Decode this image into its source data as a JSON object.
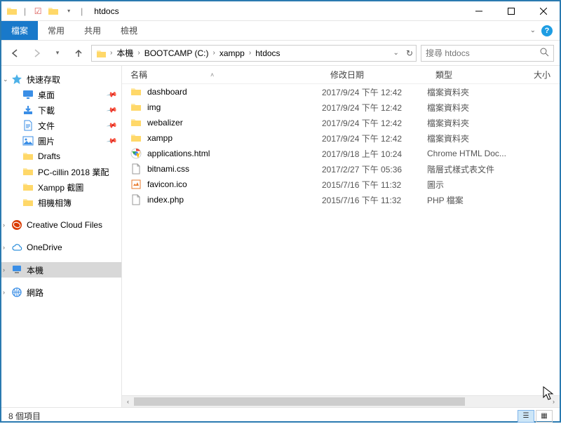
{
  "window": {
    "title": "htdocs"
  },
  "ribbon": {
    "file": "檔案",
    "home": "常用",
    "share": "共用",
    "view": "檢視"
  },
  "breadcrumb": [
    "本機",
    "BOOTCAMP (C:)",
    "xampp",
    "htdocs"
  ],
  "search": {
    "placeholder": "搜尋 htdocs"
  },
  "columns": {
    "name": "名稱",
    "date": "修改日期",
    "type": "類型",
    "size": "大小"
  },
  "sidebar": {
    "quick_access": "快速存取",
    "quick_items": [
      {
        "label": "桌面",
        "icon": "desktop",
        "pinned": true
      },
      {
        "label": "下載",
        "icon": "downloads",
        "pinned": true
      },
      {
        "label": "文件",
        "icon": "documents",
        "pinned": true
      },
      {
        "label": "圖片",
        "icon": "pictures",
        "pinned": true
      },
      {
        "label": "Drafts",
        "icon": "folder",
        "pinned": false
      },
      {
        "label": "PC-cillin 2018 業配",
        "icon": "folder",
        "pinned": false
      },
      {
        "label": "Xampp 截圖",
        "icon": "folder",
        "pinned": false
      },
      {
        "label": "相機相簿",
        "icon": "folder",
        "pinned": false
      }
    ],
    "creative_cloud": "Creative Cloud Files",
    "onedrive": "OneDrive",
    "this_pc": "本機",
    "network": "網路"
  },
  "files": [
    {
      "name": "dashboard",
      "date": "2017/9/24 下午 12:42",
      "type": "檔案資料夾",
      "icon": "folder"
    },
    {
      "name": "img",
      "date": "2017/9/24 下午 12:42",
      "type": "檔案資料夾",
      "icon": "folder"
    },
    {
      "name": "webalizer",
      "date": "2017/9/24 下午 12:42",
      "type": "檔案資料夾",
      "icon": "folder"
    },
    {
      "name": "xampp",
      "date": "2017/9/24 下午 12:42",
      "type": "檔案資料夾",
      "icon": "folder"
    },
    {
      "name": "applications.html",
      "date": "2017/9/18 上午 10:24",
      "type": "Chrome HTML Doc...",
      "icon": "chrome"
    },
    {
      "name": "bitnami.css",
      "date": "2017/2/27 下午 05:36",
      "type": "階層式樣式表文件",
      "icon": "css"
    },
    {
      "name": "favicon.ico",
      "date": "2015/7/16 下午 11:32",
      "type": "圖示",
      "icon": "ico"
    },
    {
      "name": "index.php",
      "date": "2015/7/16 下午 11:32",
      "type": "PHP 檔案",
      "icon": "php"
    }
  ],
  "status": {
    "count": "8 個項目"
  }
}
